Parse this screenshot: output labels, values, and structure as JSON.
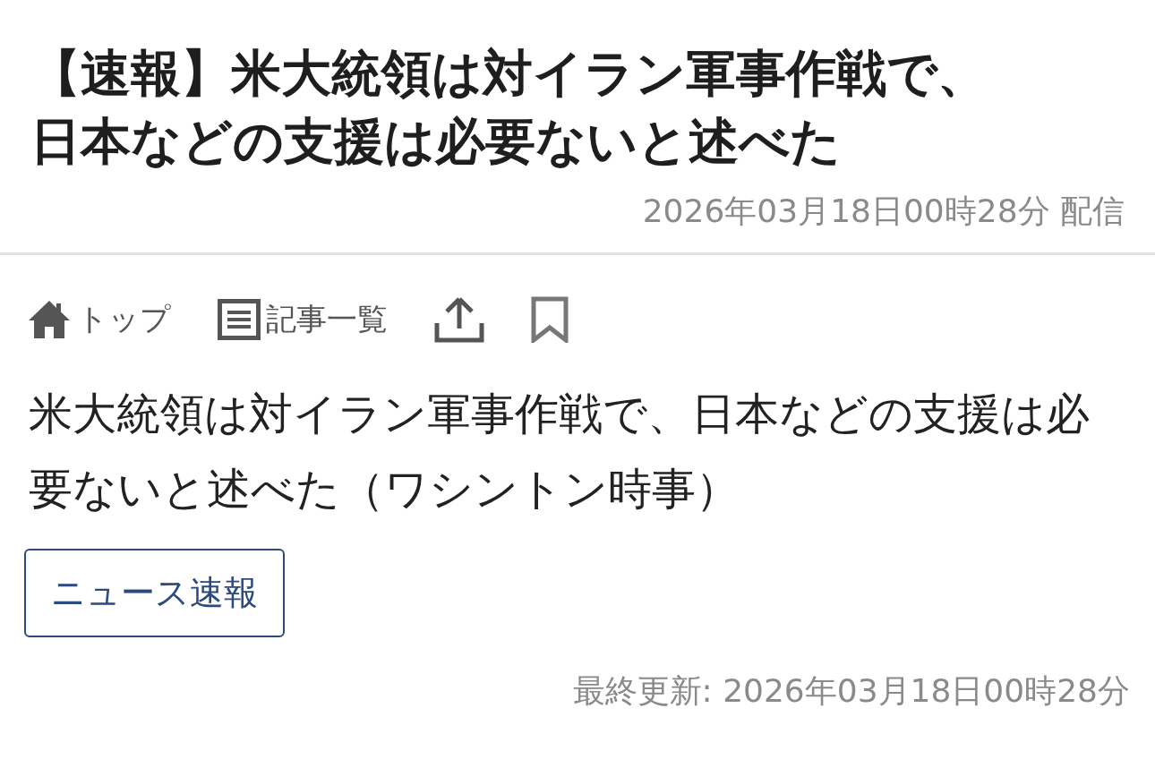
{
  "article": {
    "title": "【速報】米大統領は対イラン軍事作戦で、日本などの支援は必要ないと述べた",
    "published": "2026年03月18日00時28分 配信"
  },
  "toolbar": [
    {
      "kind": "home",
      "label": "トップ"
    },
    {
      "kind": "list",
      "label": "記事一覧"
    },
    {
      "kind": "share"
    },
    {
      "kind": "bookmark"
    }
  ],
  "body": "米大統領は対イラン軍事作戦で、日本などの支援は必要ないと述べた（ワシントン時事）",
  "tags": [
    "ニュース速報"
  ],
  "updated": "最終更新: 2026年03月18日00時28分"
}
